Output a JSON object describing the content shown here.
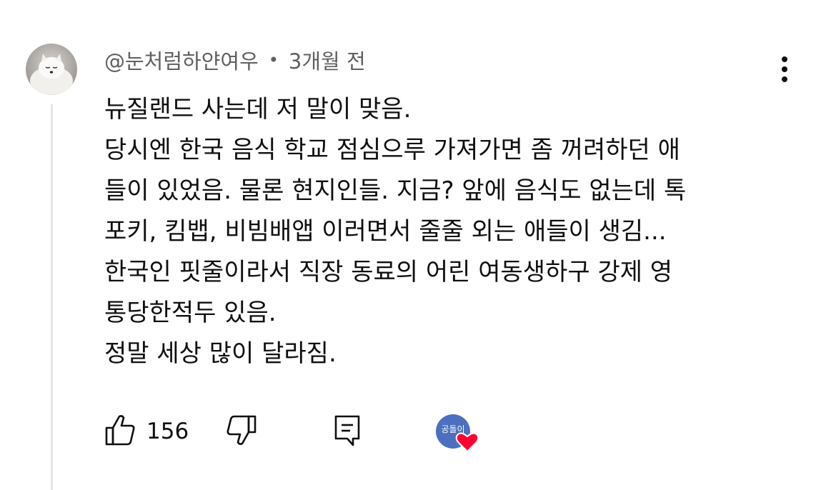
{
  "comment": {
    "author": "@눈처럼하얀여우",
    "separator": "•",
    "time_ago": "3개월 전",
    "lines": [
      "뉴질랜드 사는데 저 말이 맞음.",
      "당시엔 한국 음식 학교 점심으루 가져가면 좀 꺼려하던 애",
      "들이 있었음. 물론 현지인들. 지금? 앞에 음식도 없는데 톡",
      "포키, 킴뱁, 비빔배앱 이러면서 줄줄 외는 애들이 생김...",
      "한국인 핏줄이라서 직장 동료의 어린 여동생하구 강제 영",
      "통당한적두 있음.",
      "정말 세상 많이 달라짐."
    ],
    "like_count": "156",
    "creator_heart_avatar_text": "공돌이",
    "icons": {
      "like": "thumbs-up-icon",
      "dislike": "thumbs-down-icon",
      "reply": "reply-comment-icon",
      "more": "vertical-ellipsis-icon",
      "heart": "heart-icon"
    },
    "colors": {
      "heart": "#ff0033",
      "creator_avatar": "#4c6fc0",
      "meta_text": "#606060",
      "text": "#0f0f0f"
    }
  }
}
